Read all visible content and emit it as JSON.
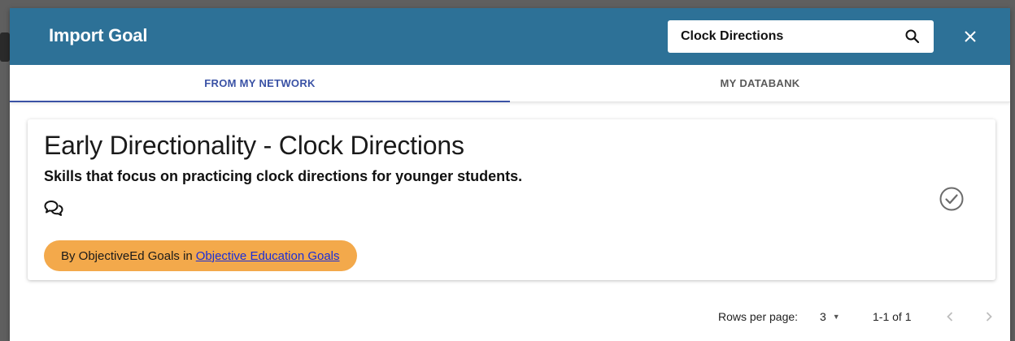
{
  "dialog": {
    "title": "Import Goal",
    "colors": {
      "header": "#2d7197",
      "accent": "#3a52a5",
      "badge": "#f3a94b"
    }
  },
  "search": {
    "value": "Clock Directions",
    "placeholder": "",
    "icon": "search-icon"
  },
  "close": {
    "icon": "close-icon"
  },
  "tabs": [
    {
      "label": "FROM MY NETWORK",
      "active": true
    },
    {
      "label": "MY DATABANK",
      "active": false
    }
  ],
  "goal": {
    "title": "Early Directionality - Clock Directions",
    "description": "Skills that focus on practicing clock directions for younger students.",
    "comment_icon": "comments-icon",
    "select_icon": "check-circle-icon",
    "source_prefix": "By ObjectiveEd Goals in",
    "source_link": "Objective Education Goals"
  },
  "pagination": {
    "rows_label": "Rows per page:",
    "rows_value": "3",
    "range": "1-1 of 1"
  }
}
